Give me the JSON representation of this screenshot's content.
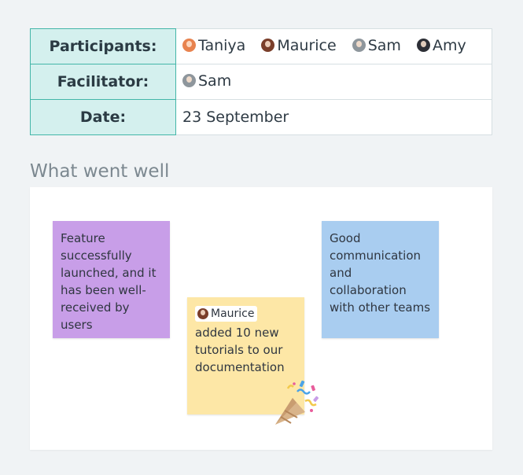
{
  "info": {
    "participants_label": "Participants:",
    "facilitator_label": "Facilitator:",
    "date_label": "Date:",
    "participants": [
      {
        "name": "Taniya",
        "color": "#e8834f"
      },
      {
        "name": "Maurice",
        "color": "#7a3e2a"
      },
      {
        "name": "Sam",
        "color": "#8e969c"
      },
      {
        "name": "Amy",
        "color": "#2d2f36"
      }
    ],
    "facilitator": {
      "name": "Sam",
      "color": "#8e969c"
    },
    "date": "23 September"
  },
  "section": {
    "title": "What went well"
  },
  "stickies": {
    "purple": {
      "text": "Feature successfully launched, and it has been well-received by users",
      "color": "#c89ee8"
    },
    "yellow": {
      "mention": "Maurice",
      "mention_avatar_color": "#7a3e2a",
      "text": "added 10 new tutorials to our documentation",
      "color": "#fde7a6"
    },
    "blue": {
      "text": "Good communication and collaboration with other teams",
      "color": "#a9cdf0"
    }
  },
  "icons": {
    "celebration": "party-popper-icon"
  }
}
